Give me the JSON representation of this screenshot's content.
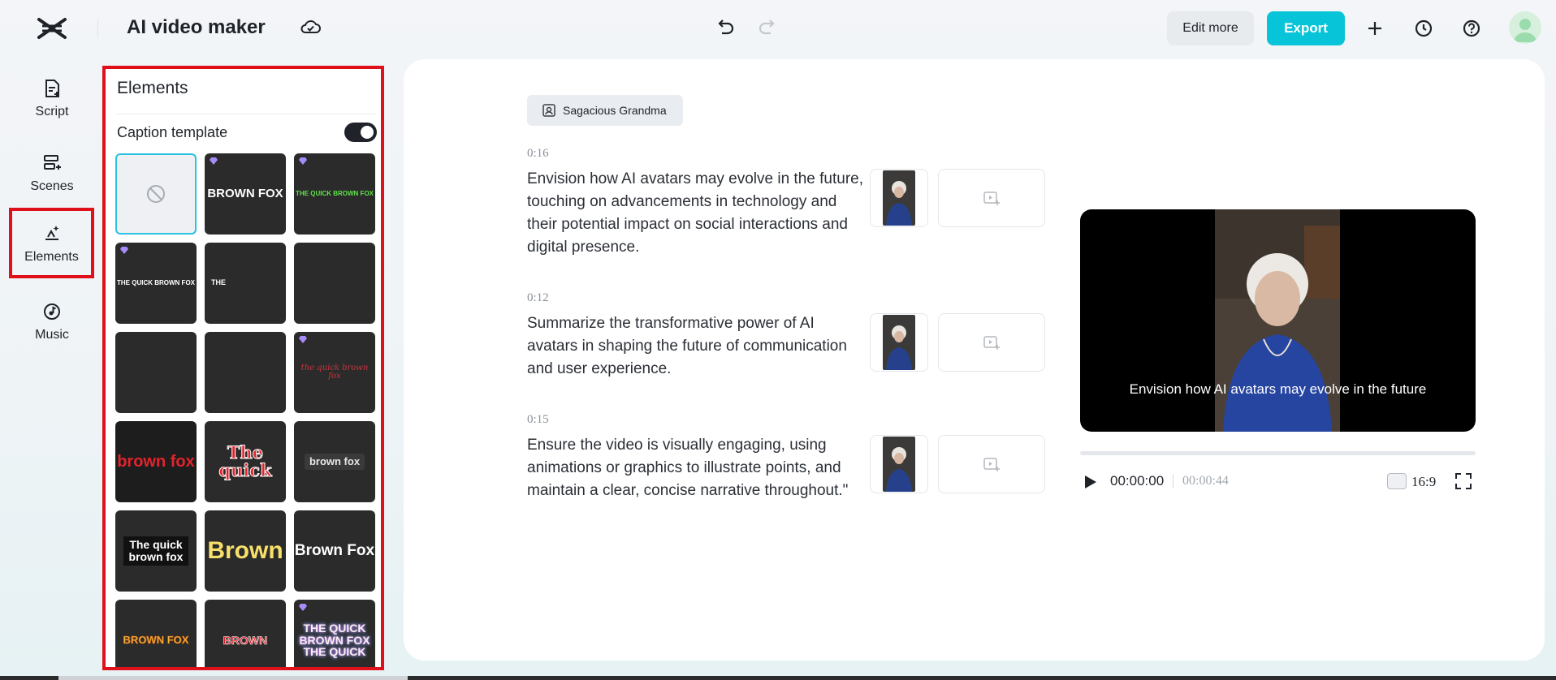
{
  "header": {
    "app_title": "AI video maker",
    "edit_more_label": "Edit more",
    "export_label": "Export",
    "colors": {
      "export_bg": "#08c4d8",
      "highlight": "#e0101a"
    }
  },
  "nav": {
    "items": [
      {
        "label": "Script",
        "icon": "script-icon"
      },
      {
        "label": "Scenes",
        "icon": "scenes-icon"
      },
      {
        "label": "Elements",
        "icon": "elements-icon",
        "active": true
      },
      {
        "label": "Music",
        "icon": "music-icon"
      }
    ]
  },
  "panel": {
    "title": "Elements",
    "caption_template_label": "Caption template",
    "caption_template_enabled": true,
    "templates": [
      {
        "text": "",
        "style": "none",
        "selected": true
      },
      {
        "text": "BROWN FOX",
        "premium": true
      },
      {
        "text": "THE QUICK BROWN FOX",
        "premium": true
      },
      {
        "text": "THE QUICK BROWN FOX",
        "premium": true
      },
      {
        "text": "THE",
        "premium": false
      },
      {
        "text": "",
        "premium": false
      },
      {
        "text": "",
        "premium": false
      },
      {
        "text": "",
        "premium": false
      },
      {
        "text": "the quick brown fox",
        "premium": true
      },
      {
        "text": "brown fox",
        "premium": false
      },
      {
        "text": "The quick",
        "premium": false
      },
      {
        "text": "brown fox",
        "premium": false
      },
      {
        "text": "The quick brown fox",
        "premium": false
      },
      {
        "text": "Brown",
        "premium": false
      },
      {
        "text": "Brown Fox",
        "premium": false
      },
      {
        "text": "BROWN FOX",
        "premium": false
      },
      {
        "text": "BROWN",
        "premium": false
      },
      {
        "text": "THE QUICK BROWN FOX THE QUICK",
        "premium": true
      }
    ]
  },
  "script": {
    "speaker": "Sagacious Grandma",
    "segments": [
      {
        "time": "0:16",
        "text": "Envision how AI avatars may evolve in the future, touching on advancements in technology and their potential impact on social interactions and digital presence."
      },
      {
        "time": "0:12",
        "text": "Summarize the transformative power of AI avatars in shaping the future of communication and user experience."
      },
      {
        "time": "0:15",
        "text": "Ensure the video is visually engaging, using animations or graphics to illustrate points, and maintain a clear, concise narrative throughout.\""
      }
    ]
  },
  "player": {
    "caption": "Envision how AI avatars may evolve in the future",
    "current_time": "00:00:00",
    "total_time": "00:00:44",
    "aspect_ratio": "16:9",
    "progress": 0
  }
}
